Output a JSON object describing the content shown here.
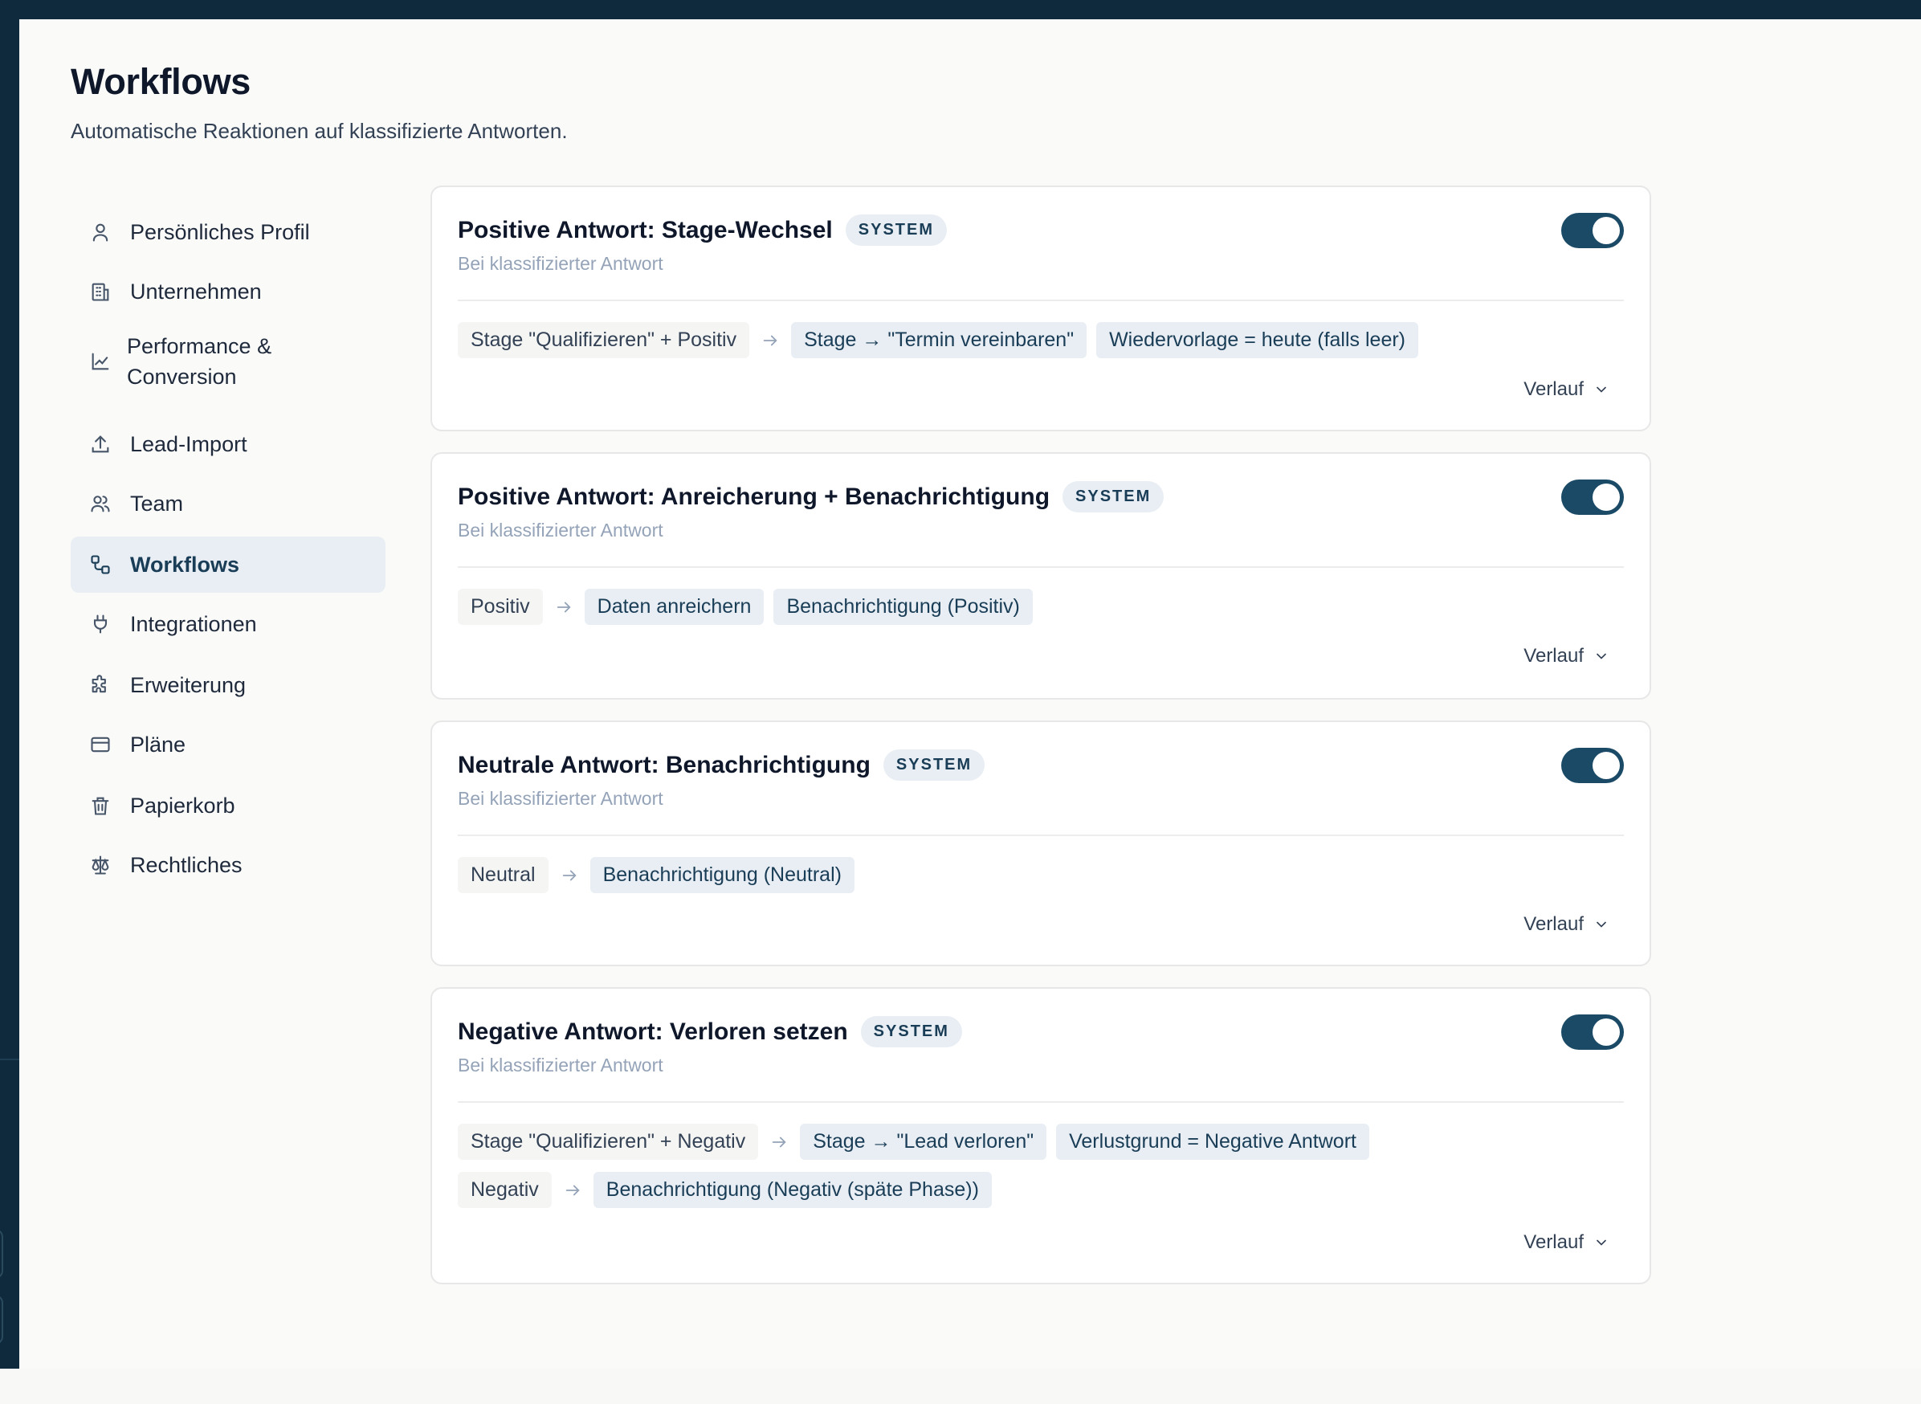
{
  "page": {
    "title": "Workflows",
    "subtitle": "Automatische Reaktionen auf klassifizierte Antworten."
  },
  "sidebar": {
    "items": [
      {
        "label": "Persönliches Profil",
        "icon": "user-icon"
      },
      {
        "label": "Unternehmen",
        "icon": "building-icon"
      },
      {
        "label": "Performance & Conversion",
        "icon": "chart-line-icon"
      },
      {
        "label": "Lead-Import",
        "icon": "upload-icon"
      },
      {
        "label": "Team",
        "icon": "users-icon"
      },
      {
        "label": "Workflows",
        "icon": "workflow-icon",
        "active": true
      },
      {
        "label": "Integrationen",
        "icon": "plug-icon"
      },
      {
        "label": "Erweiterung",
        "icon": "puzzle-icon"
      },
      {
        "label": "Pläne",
        "icon": "credit-card-icon"
      },
      {
        "label": "Papierkorb",
        "icon": "trash-icon"
      },
      {
        "label": "Rechtliches",
        "icon": "scale-icon"
      }
    ]
  },
  "workflows": [
    {
      "title": "Positive Antwort: Stage-Wechsel",
      "badge": "SYSTEM",
      "trigger": "Bei klassifizierter Antwort",
      "enabled": true,
      "rules": [
        {
          "condition": "Stage \"Qualifizieren\" + Positiv",
          "actions": [
            "Stage → \"Termin vereinbaren\"",
            "Wiedervorlage = heute (falls leer)"
          ]
        }
      ],
      "history_label": "Verlauf"
    },
    {
      "title": "Positive Antwort: Anreicherung + Benachrichtigung",
      "badge": "SYSTEM",
      "trigger": "Bei klassifizierter Antwort",
      "enabled": true,
      "rules": [
        {
          "condition": "Positiv",
          "actions": [
            "Daten anreichern",
            "Benachrichtigung (Positiv)"
          ]
        }
      ],
      "history_label": "Verlauf"
    },
    {
      "title": "Neutrale Antwort: Benachrichtigung",
      "badge": "SYSTEM",
      "trigger": "Bei klassifizierter Antwort",
      "enabled": true,
      "rules": [
        {
          "condition": "Neutral",
          "actions": [
            "Benachrichtigung (Neutral)"
          ]
        }
      ],
      "history_label": "Verlauf"
    },
    {
      "title": "Negative Antwort: Verloren setzen",
      "badge": "SYSTEM",
      "trigger": "Bei klassifizierter Antwort",
      "enabled": true,
      "rules": [
        {
          "condition": "Stage \"Qualifizieren\" + Negativ",
          "actions": [
            "Stage → \"Lead verloren\"",
            "Verlustgrund = Negative Antwort"
          ]
        },
        {
          "condition": "Negativ",
          "actions": [
            "Benachrichtigung (Negativ (späte Phase))"
          ]
        }
      ],
      "history_label": "Verlauf"
    }
  ],
  "colors": {
    "frame": "#0f2a3c",
    "accent": "#1a4a66",
    "chip_action_bg": "#e8eef3",
    "chip_condition_bg": "#f5f5f4"
  }
}
